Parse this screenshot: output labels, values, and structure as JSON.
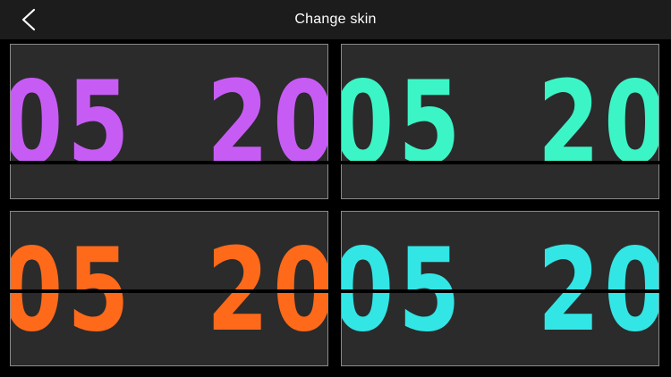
{
  "header": {
    "title": "Change skin",
    "back_icon": "chevron-left-icon"
  },
  "skins": [
    {
      "hours": "05",
      "minutes": "20",
      "color": "#c75cf5"
    },
    {
      "hours": "05",
      "minutes": "20",
      "color": "#3cf5c6"
    },
    {
      "hours": "05",
      "minutes": "20",
      "color": "#ff6a1a"
    },
    {
      "hours": "05",
      "minutes": "20",
      "color": "#33e6e6"
    }
  ]
}
